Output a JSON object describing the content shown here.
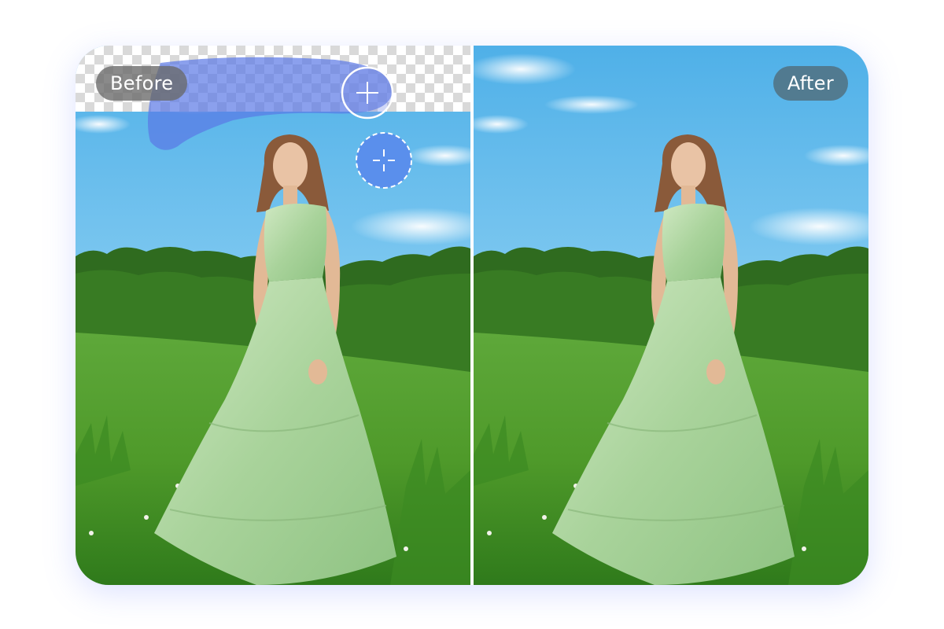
{
  "comparison": {
    "before_label": "Before",
    "after_label": "After"
  },
  "tools": {
    "add_icon": "plus-circle-icon",
    "brush_cursor_icon": "crosshair-brush-icon"
  },
  "colors": {
    "sky": "#6ec0ec",
    "brush_overlay": "#5a78e6",
    "grass": "#4f9e2c",
    "trees": "#2f6b1f",
    "dress": "#b6d9a8"
  }
}
